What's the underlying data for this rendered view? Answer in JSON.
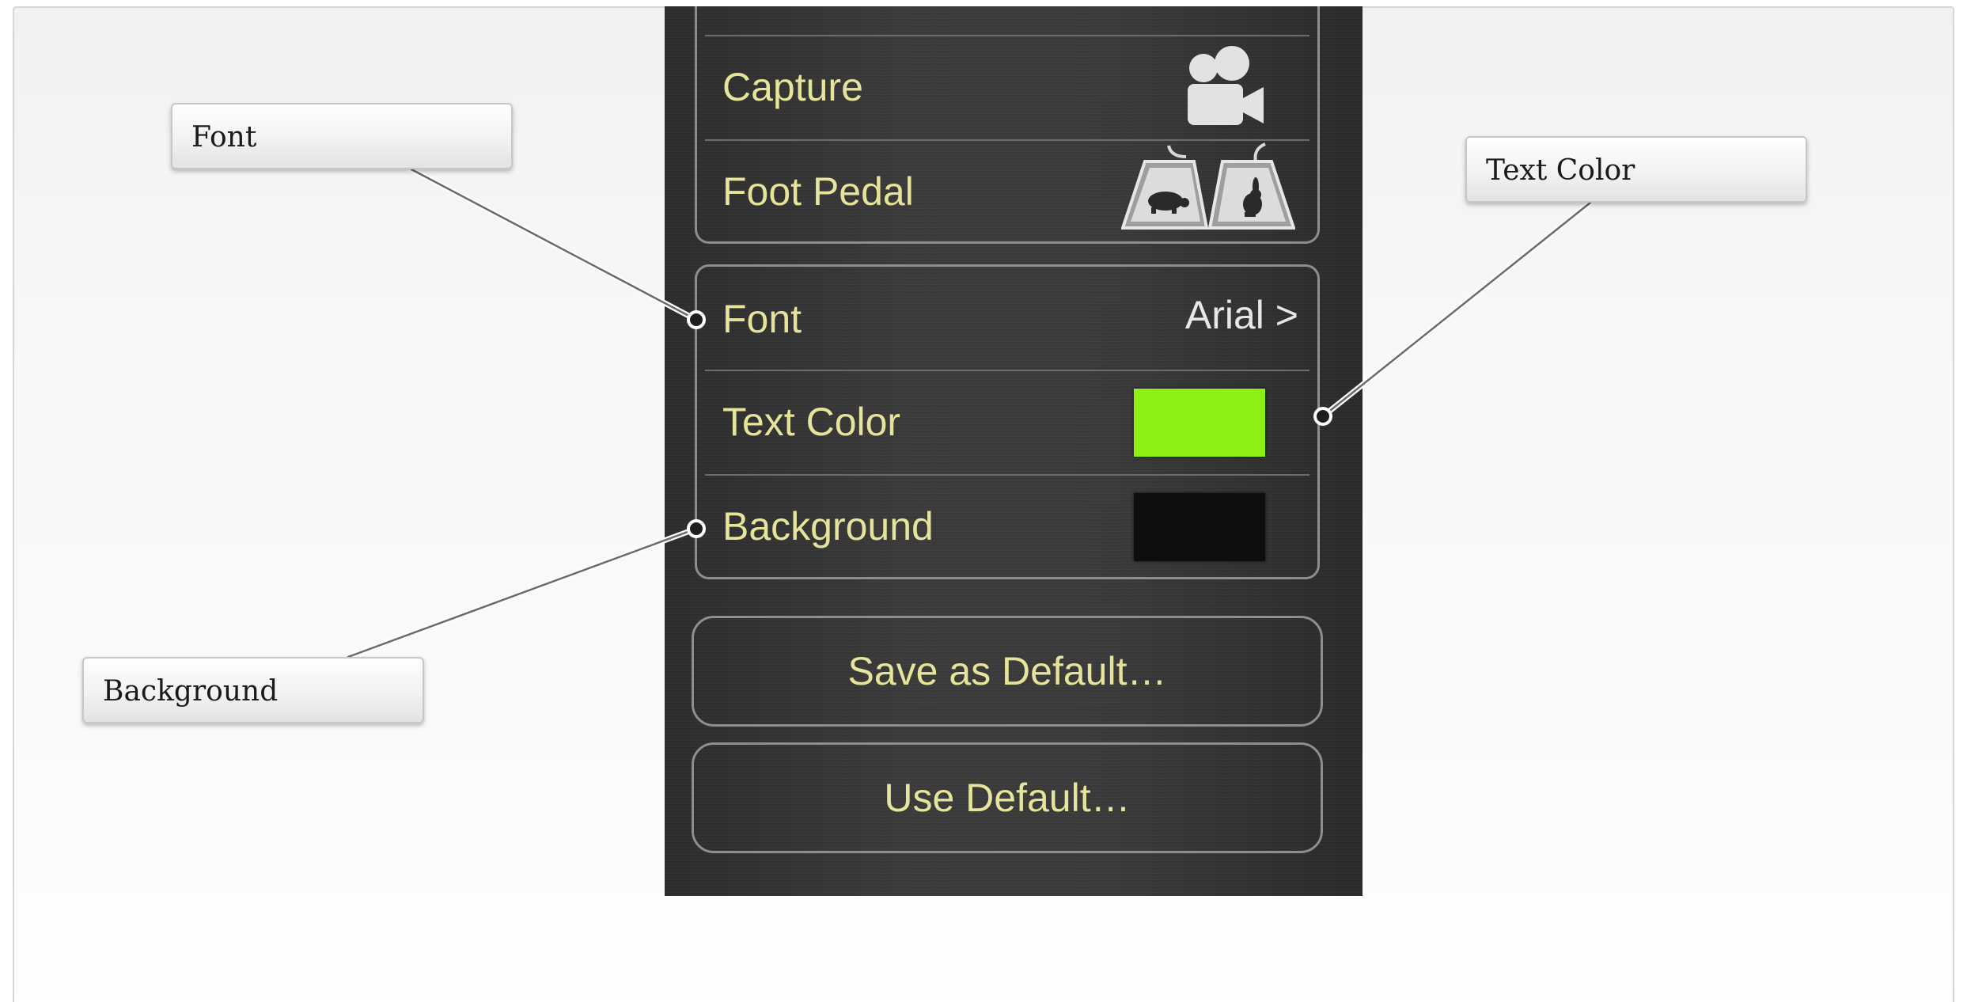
{
  "panel": {
    "top_group": {
      "rows": [
        {
          "label": "Capture",
          "icon": "video-camera-icon"
        },
        {
          "label": "Foot Pedal",
          "icon": "foot-pedal-icon"
        }
      ]
    },
    "text_group": {
      "font": {
        "label": "Font",
        "value": "Arial >"
      },
      "text_color": {
        "label": "Text Color",
        "color": "#8EF012"
      },
      "background": {
        "label": "Background",
        "color": "#0E0E0E"
      }
    },
    "buttons": {
      "save_default": "Save as Default…",
      "use_default": "Use Default…"
    }
  },
  "callouts": {
    "font": "Font",
    "text_color": "Text Color",
    "background": "Background"
  },
  "colors": {
    "panel_text": "#E6E39B",
    "panel_value_text": "#E7E7EA",
    "panel_border": "#8D8D93",
    "panel_background": "#363636"
  }
}
